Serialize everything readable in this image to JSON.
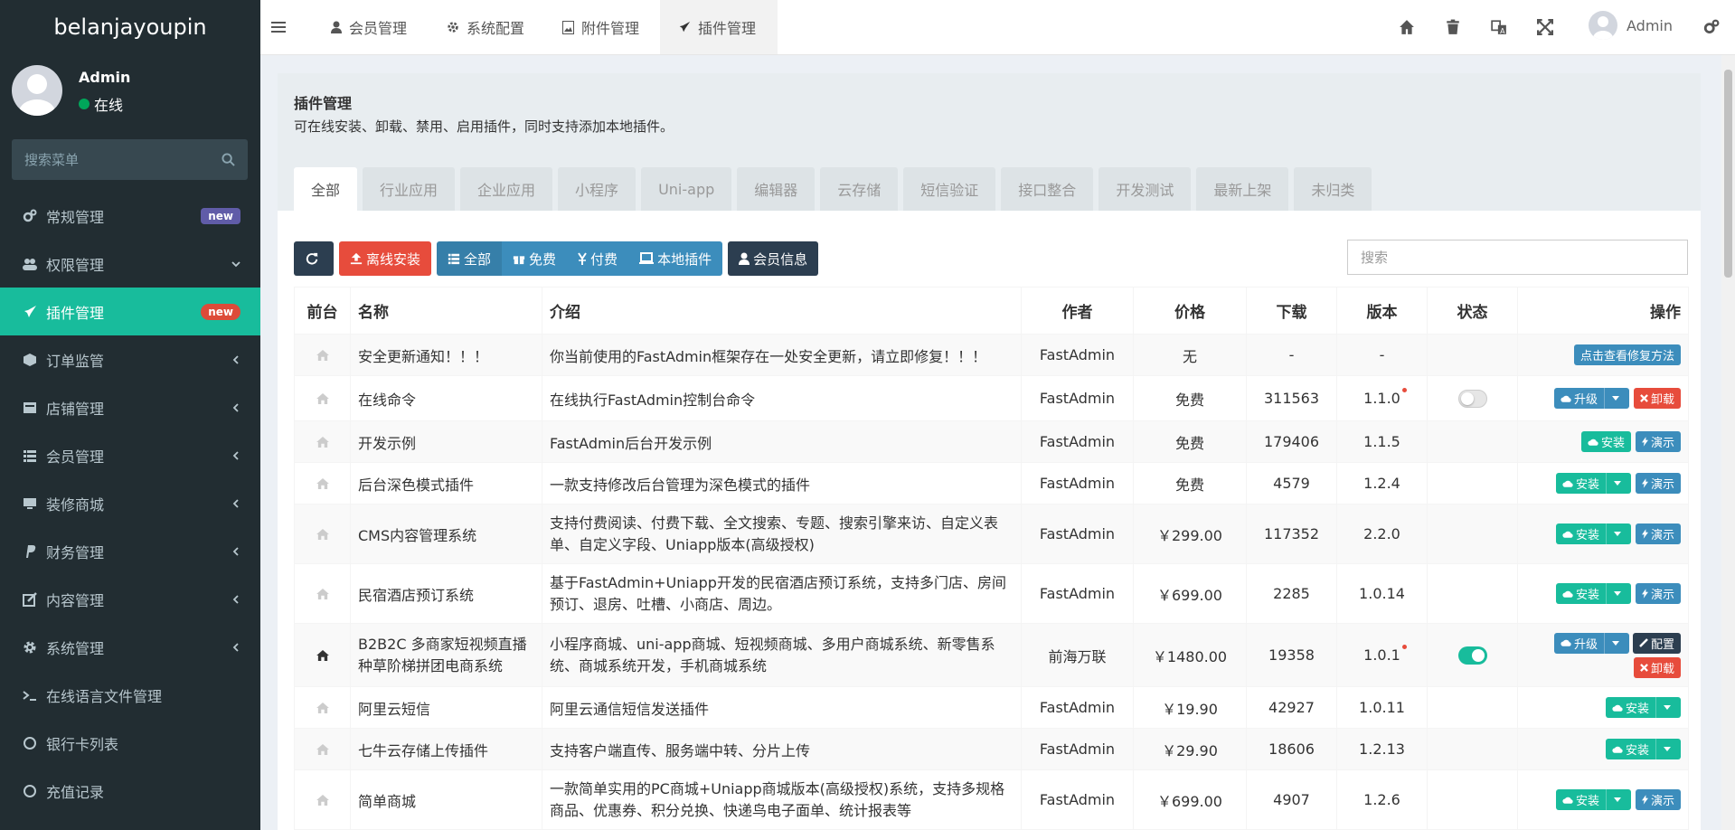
{
  "brand": "belanjayoupin",
  "user": {
    "name": "Admin",
    "status": "在线"
  },
  "sidebar_search": {
    "placeholder": "搜索菜单"
  },
  "menu": [
    {
      "label": "常规管理",
      "badge": "new"
    },
    {
      "label": "权限管理"
    },
    {
      "label": "插件管理",
      "badge": "new"
    },
    {
      "label": "订单监管"
    },
    {
      "label": "店铺管理"
    },
    {
      "label": "会员管理"
    },
    {
      "label": "装修商城"
    },
    {
      "label": "财务管理"
    },
    {
      "label": "内容管理"
    },
    {
      "label": "系统管理"
    },
    {
      "label": "在线语言文件管理"
    },
    {
      "label": "银行卡列表"
    },
    {
      "label": "充值记录"
    }
  ],
  "header": {
    "tabs": [
      "会员管理",
      "系统配置",
      "附件管理",
      "插件管理"
    ],
    "admin": "Admin"
  },
  "page": {
    "title": "插件管理",
    "desc": "可在线安装、卸载、禁用、启用插件，同时支持添加本地插件。"
  },
  "categories": [
    "全部",
    "行业应用",
    "企业应用",
    "小程序",
    "Uni-app",
    "编辑器",
    "云存储",
    "短信验证",
    "接口整合",
    "开发测试",
    "最新上架",
    "未归类"
  ],
  "toolbar": {
    "offline": "离线安装",
    "all": "全部",
    "free": "免费",
    "paid": "付费",
    "local": "本地插件",
    "member": "会员信息",
    "search_placeholder": "搜索"
  },
  "table": {
    "headers": [
      "前台",
      "名称",
      "介绍",
      "作者",
      "价格",
      "下载",
      "版本",
      "状态",
      "操作"
    ],
    "rows": [
      {
        "name": "安全更新通知！！！",
        "intro": "你当前使用的FastAdmin框架存在一处安全更新，请立即修复！！！",
        "author": "FastAdmin",
        "price": "无",
        "downloads": "-",
        "version": "-",
        "ops": [
          "点击查看修复方法"
        ]
      },
      {
        "name": "在线命令",
        "intro": "在线执行FastAdmin控制台命令",
        "author": "FastAdmin",
        "price": "免费",
        "downloads": "311563",
        "version": "1.1.0",
        "ops": [
          "升级",
          "卸载"
        ]
      },
      {
        "name": "开发示例",
        "intro": "FastAdmin后台开发示例",
        "author": "FastAdmin",
        "price": "免费",
        "downloads": "179406",
        "version": "1.1.5",
        "ops": [
          "安装",
          "演示"
        ]
      },
      {
        "name": "后台深色模式插件",
        "intro": "一款支持修改后台管理为深色模式的插件",
        "author": "FastAdmin",
        "price": "免费",
        "downloads": "4579",
        "version": "1.2.4",
        "ops": [
          "安装",
          "演示"
        ]
      },
      {
        "name": "CMS内容管理系统",
        "intro": "支持付费阅读、付费下载、全文搜索、专题、搜索引擎来访、自定义表单、自定义字段、Uniapp版本(高级授权)",
        "author": "FastAdmin",
        "price": "￥299.00",
        "downloads": "117352",
        "version": "2.2.0",
        "ops": [
          "安装",
          "演示"
        ]
      },
      {
        "name": "民宿酒店预订系统",
        "intro": "基于FastAdmin+Uniapp开发的民宿酒店预订系统，支持多门店、房间预订、退房、吐槽、小商店、周边。",
        "author": "FastAdmin",
        "price": "￥699.00",
        "downloads": "2285",
        "version": "1.0.14",
        "ops": [
          "安装",
          "演示"
        ]
      },
      {
        "name": "B2B2C 多商家短视频直播种草阶梯拼团电商系统",
        "intro": "小程序商城、uni-app商城、短视频商城、多用户商城系统、新零售系统、商城系统开发，手机商城系统",
        "author": "前海万联",
        "price": "￥1480.00",
        "downloads": "19358",
        "version": "1.0.1",
        "ops": [
          "升级",
          "配置",
          "卸载"
        ]
      },
      {
        "name": "阿里云短信",
        "intro": "阿里云通信短信发送插件",
        "author": "FastAdmin",
        "price": "￥19.90",
        "downloads": "42927",
        "version": "1.0.11",
        "ops": [
          "安装"
        ]
      },
      {
        "name": "七牛云存储上传插件",
        "intro": "支持客户端直传、服务端中转、分片上传",
        "author": "FastAdmin",
        "price": "￥29.90",
        "downloads": "18606",
        "version": "1.2.13",
        "ops": [
          "安装"
        ]
      },
      {
        "name": "简单商城",
        "intro": "一款简单实用的PC商城+Uniapp商城版本(高级授权)系统，支持多规格商品、优惠券、积分兑换、快递鸟电子面单、统计报表等",
        "author": "FastAdmin",
        "price": "￥699.00",
        "downloads": "4907",
        "version": "1.2.6",
        "ops": [
          "安装",
          "演示"
        ]
      }
    ]
  },
  "colors": {
    "sidebar": "#222d32",
    "accent": "#18bc9c",
    "danger": "#e74c3c",
    "primary": "#3c8dbc",
    "dark": "#2c3e50"
  }
}
